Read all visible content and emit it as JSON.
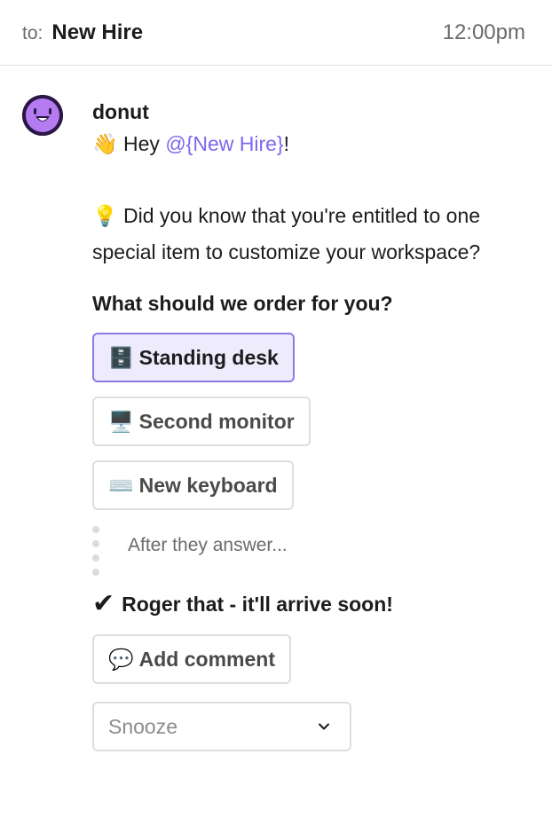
{
  "header": {
    "to_label": "to:",
    "to_value": "New Hire",
    "time": "12:00pm"
  },
  "message": {
    "sender": "donut",
    "greeting_emoji": "👋",
    "greeting_prefix": "Hey ",
    "mention": "@{New Hire}",
    "greeting_suffix": "!",
    "tip_emoji": "💡",
    "tip_text": "Did you know that you're entitled to one special item to customize your workspace?",
    "question": "What should we order for you?",
    "options": [
      {
        "icon": "🗄️",
        "label": "Standing desk",
        "selected": true
      },
      {
        "icon": "🖥️",
        "label": "Second monitor",
        "selected": false
      },
      {
        "icon": "⌨️",
        "label": "New keyboard",
        "selected": false
      }
    ],
    "after_text": "After they answer...",
    "confirm_icon": "✔",
    "confirm_text": "Roger that - it'll arrive soon!",
    "comment_icon": "💬",
    "comment_label": "Add comment",
    "snooze_placeholder": "Snooze"
  },
  "colors": {
    "accent": "#7b68ee",
    "avatar_bg": "#2a1745",
    "avatar_face": "#a855f7",
    "selected_bg": "#eeebfc"
  }
}
